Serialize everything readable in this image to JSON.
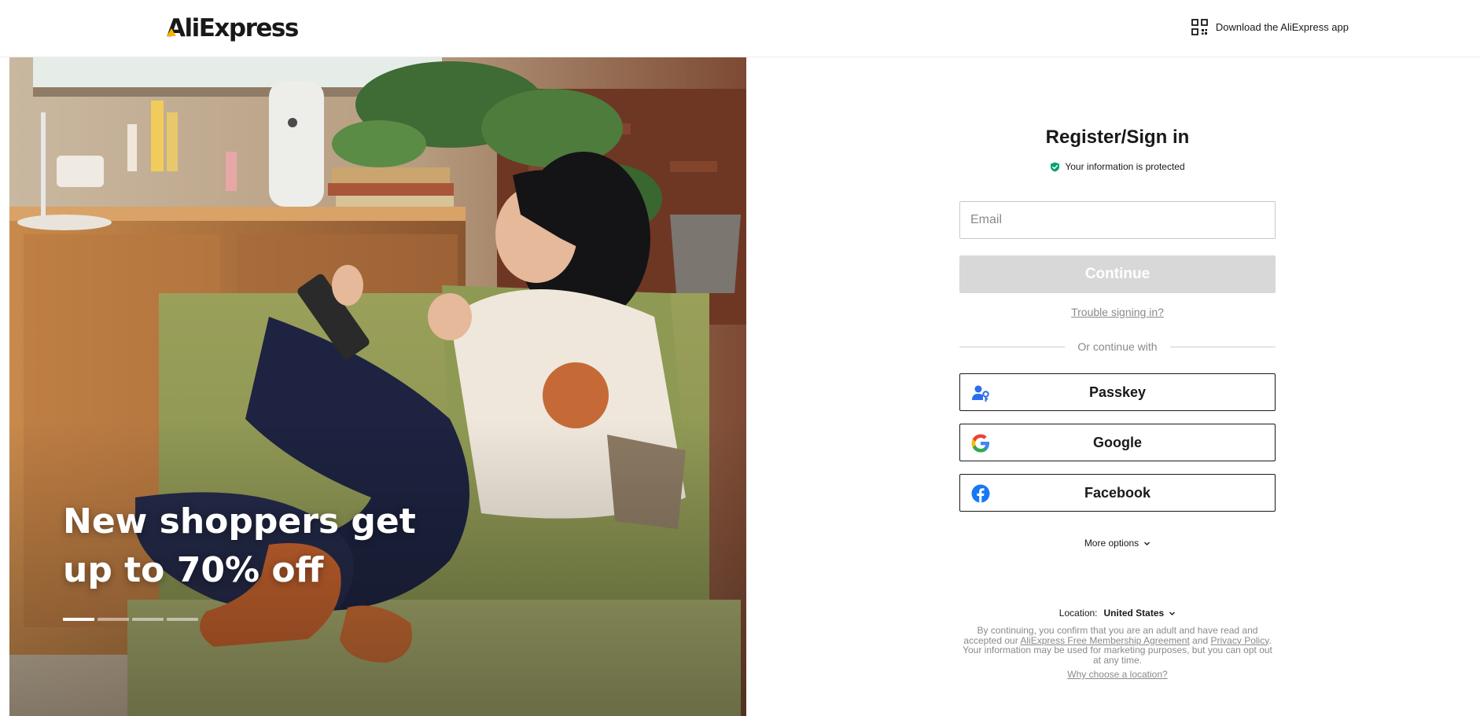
{
  "header": {
    "logo_text": "AliExpress",
    "download_label": "Download the AliExpress app",
    "download_icon": "qr-code-icon"
  },
  "hero": {
    "title": "New shoppers get up to 70% off",
    "carousel": {
      "total": 4,
      "active": 1
    }
  },
  "form": {
    "title": "Register/Sign in",
    "protected_text": "Your information is protected",
    "protected_icon": "shield-check-icon",
    "email_placeholder": "Email",
    "email_value": "",
    "continue_label": "Continue",
    "trouble_label": "Trouble signing in?",
    "or_label": "Or continue with",
    "social": [
      {
        "label": "Passkey",
        "icon": "passkey-icon"
      },
      {
        "label": "Google",
        "icon": "google-icon"
      },
      {
        "label": "Facebook",
        "icon": "facebook-icon"
      }
    ],
    "more_options": "More options",
    "location_label": "Location:",
    "location_value": "United States",
    "terms": {
      "before": "By continuing, you confirm that you are an adult and have read and accepted our ",
      "membership_link": "AliExpress Free Membership Agreement",
      "and": " and ",
      "privacy_link": "Privacy Policy",
      "after": ". Your information may be used for marketing purposes, but you can opt out at any time."
    },
    "why_location": "Why choose a location?"
  },
  "colors": {
    "accent_yellow": "#f7b500",
    "continue_disabled": "#d8d8d8",
    "shield_green": "#00a36a",
    "passkey_blue": "#2a6ee8",
    "facebook_blue": "#1877f2"
  }
}
